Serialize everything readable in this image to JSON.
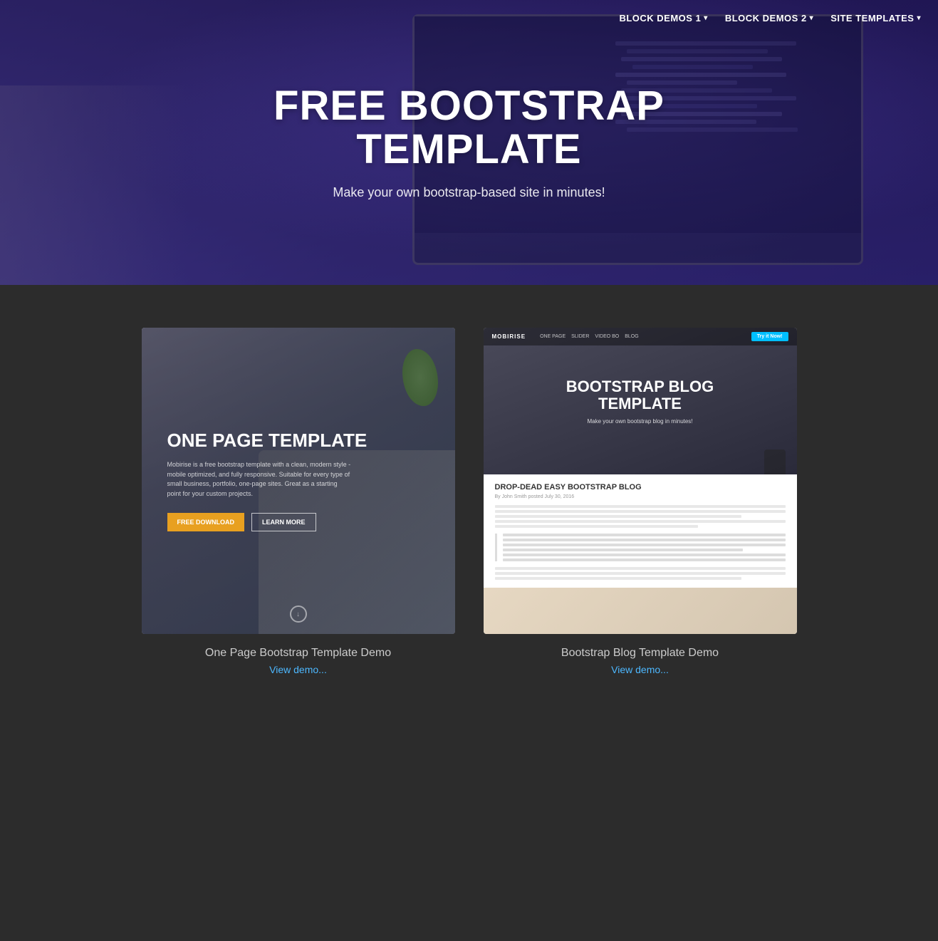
{
  "nav": {
    "items": [
      {
        "label": "BLOCK DEMOS 1",
        "has_dropdown": true
      },
      {
        "label": "BLOCK DEMOS 2",
        "has_dropdown": true
      },
      {
        "label": "SITE TEMPLATES",
        "has_dropdown": true
      }
    ]
  },
  "hero": {
    "title": "FREE BOOTSTRAP\nTEMPLATE",
    "subtitle": "Make your own bootstrap-based site in minutes!"
  },
  "templates": [
    {
      "id": "one-page",
      "preview_title": "ONE PAGE TEMPLATE",
      "preview_description": "Mobirise is a free bootstrap template with a clean, modern style - mobile optimized, and fully responsive. Suitable for every type of small business, portfolio, one-page sites. Great as a starting point for your custom projects.",
      "btn_primary": "FREE DOWNLOAD",
      "btn_secondary": "LEARN MORE",
      "card_title": "One Page Bootstrap Template Demo",
      "link_text": "View demo..."
    },
    {
      "id": "blog",
      "preview_title_line1": "BOOTSTRAP BLOG",
      "preview_title_line2": "TEMPLATE",
      "preview_subtitle": "Make your own bootstrap blog in minutes!",
      "blog_brand": "MOBIRISE",
      "blog_nav_links": [
        "ONE PAGE",
        "SLIDER",
        "VIDEO BO",
        "BLOG"
      ],
      "blog_nav_btn": "Try it Now!",
      "blog_article_title": "DROP-DEAD EASY BOOTSTRAP BLOG",
      "blog_byline": "By John Smith posted July 30, 2016",
      "card_title": "Bootstrap Blog Template Demo",
      "link_text": "View demo..."
    }
  ]
}
